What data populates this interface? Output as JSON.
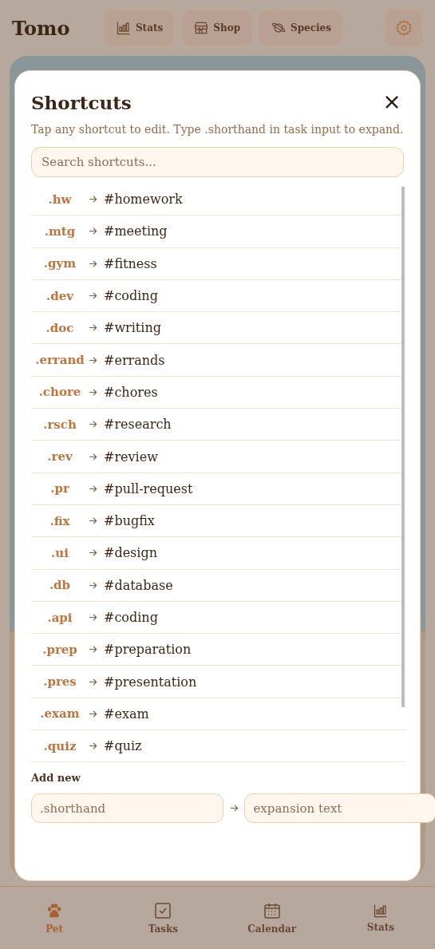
{
  "header": {
    "title": "Tomo",
    "buttons": [
      {
        "kind": "stats",
        "label": "Stats"
      },
      {
        "kind": "shop",
        "label": "Shop"
      },
      {
        "kind": "species",
        "label": "Species"
      }
    ]
  },
  "dialog": {
    "title": "Shortcuts",
    "hint": "Tap any shortcut to edit. Type .shorthand in task input to expand.",
    "search": {
      "placeholder": "Search shortcuts..."
    },
    "shortcuts": [
      {
        "code": ".hw",
        "expansion": "#homework"
      },
      {
        "code": ".mtg",
        "expansion": "#meeting"
      },
      {
        "code": ".gym",
        "expansion": "#fitness"
      },
      {
        "code": ".dev",
        "expansion": "#coding"
      },
      {
        "code": ".doc",
        "expansion": "#writing"
      },
      {
        "code": ".errand",
        "expansion": "#errands"
      },
      {
        "code": ".chore",
        "expansion": "#chores"
      },
      {
        "code": ".rsch",
        "expansion": "#research"
      },
      {
        "code": ".rev",
        "expansion": "#review"
      },
      {
        "code": ".pr",
        "expansion": "#pull-request"
      },
      {
        "code": ".fix",
        "expansion": "#bugfix"
      },
      {
        "code": ".ui",
        "expansion": "#design"
      },
      {
        "code": ".db",
        "expansion": "#database"
      },
      {
        "code": ".api",
        "expansion": "#coding"
      },
      {
        "code": ".prep",
        "expansion": "#preparation"
      },
      {
        "code": ".pres",
        "expansion": "#presentation"
      },
      {
        "code": ".exam",
        "expansion": "#exam"
      },
      {
        "code": ".quiz",
        "expansion": "#quiz"
      }
    ],
    "add_new": {
      "label": "Add new",
      "shorthand": {
        "placeholder": ".shorthand"
      },
      "expansion": {
        "placeholder": "expansion text"
      }
    }
  },
  "nav": [
    {
      "kind": "pet",
      "label": "Pet",
      "selected": true
    },
    {
      "kind": "tasks",
      "label": "Tasks",
      "selected": false
    },
    {
      "kind": "calendar",
      "label": "Calendar",
      "selected": false
    },
    {
      "kind": "stats",
      "label": "Stats",
      "selected": false
    }
  ]
}
